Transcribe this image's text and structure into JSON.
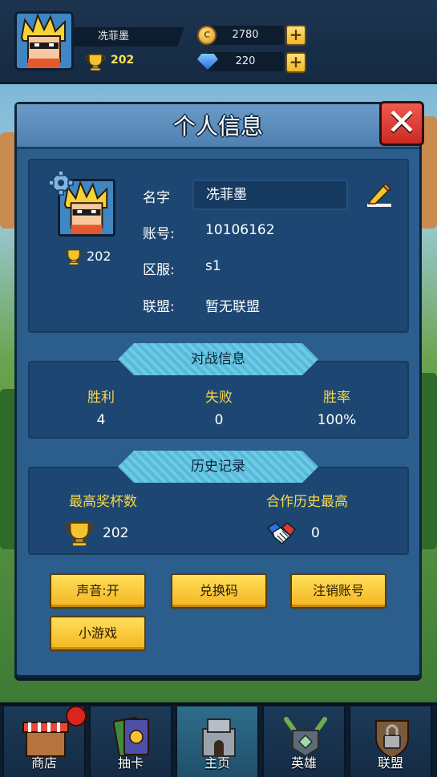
{
  "hud": {
    "player_name": "冼菲墨",
    "trophies": "202",
    "gold": "2780",
    "gems": "220",
    "plus": "+"
  },
  "modal": {
    "title": "个人信息",
    "close": "✕",
    "profile": {
      "trophies": "202",
      "name_label": "名字",
      "name_value": "冼菲墨",
      "account_label": "账号:",
      "account_value": "10106162",
      "server_label": "区服:",
      "server_value": "s1",
      "alliance_label": "联盟:",
      "alliance_value": "暂无联盟"
    },
    "battle": {
      "title": "对战信息",
      "wins_label": "胜利",
      "wins": "4",
      "losses_label": "失败",
      "losses": "0",
      "rate_label": "胜率",
      "rate": "100%"
    },
    "history": {
      "title": "历史记录",
      "max_trophies_label": "最高奖杯数",
      "max_trophies": "202",
      "coop_label": "合作历史最高",
      "coop": "0"
    },
    "buttons": {
      "sound": "声音:开",
      "redeem": "兑换码",
      "logout": "注销账号",
      "minigame": "小游戏"
    }
  },
  "nav": {
    "shop": "商店",
    "draw": "抽卡",
    "home": "主页",
    "hero": "英雄",
    "alliance": "联盟"
  },
  "icons": {
    "avatar": "spiky-hair-hero-icon",
    "trophy": "trophy-icon",
    "coin": "coin-icon",
    "gem": "diamond-icon",
    "gear": "gear-icon",
    "edit": "pencil-icon",
    "handshake": "handshake-icon"
  }
}
